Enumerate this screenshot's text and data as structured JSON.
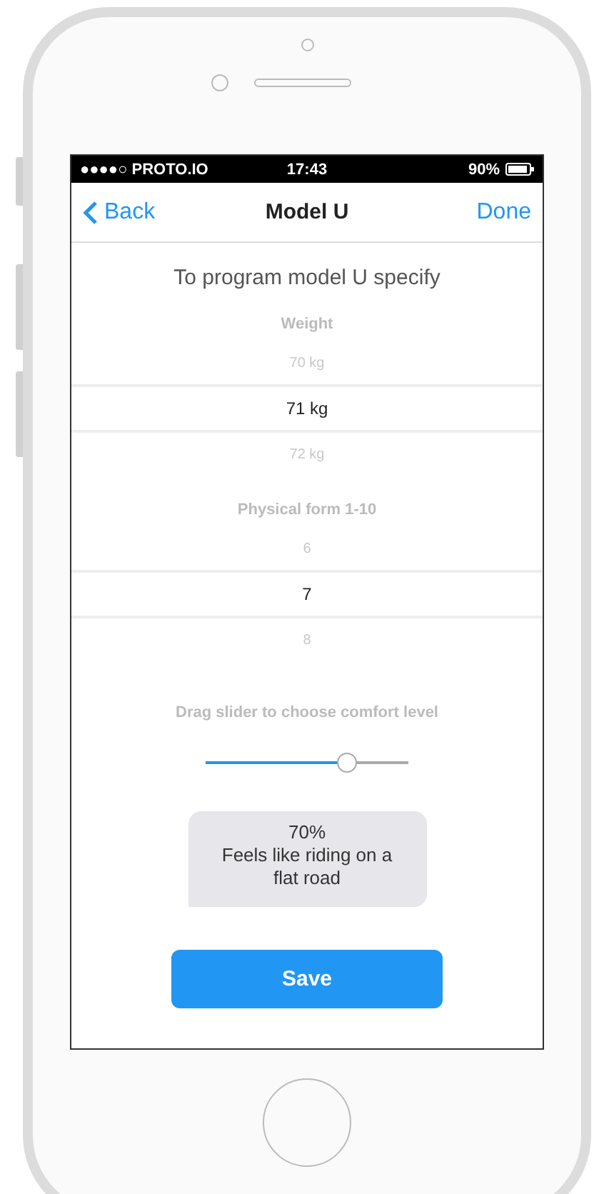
{
  "status_bar": {
    "carrier": "●●●●○ PROTO.IO",
    "time": "17:43",
    "battery": "90%"
  },
  "nav_bar": {
    "back": "Back",
    "title": "Model U",
    "done": "Done"
  },
  "intro": "To program model U specify",
  "pickers": [
    {
      "label": "Weight",
      "options": [
        {
          "text": "70 kg",
          "selected": false
        },
        {
          "text": "71 kg",
          "selected": true
        },
        {
          "text": "72 kg",
          "selected": false
        }
      ]
    },
    {
      "label": "Physical form 1-10",
      "options": [
        {
          "text": "6",
          "selected": false
        },
        {
          "text": "7",
          "selected": true
        },
        {
          "text": "8",
          "selected": false
        }
      ]
    }
  ],
  "slider": {
    "label": "Drag slider to choose comfort level",
    "level": 0.7
  },
  "bubble": {
    "reading": "70%",
    "description": "Feels like riding on a flat road"
  },
  "save_button": "Save"
}
